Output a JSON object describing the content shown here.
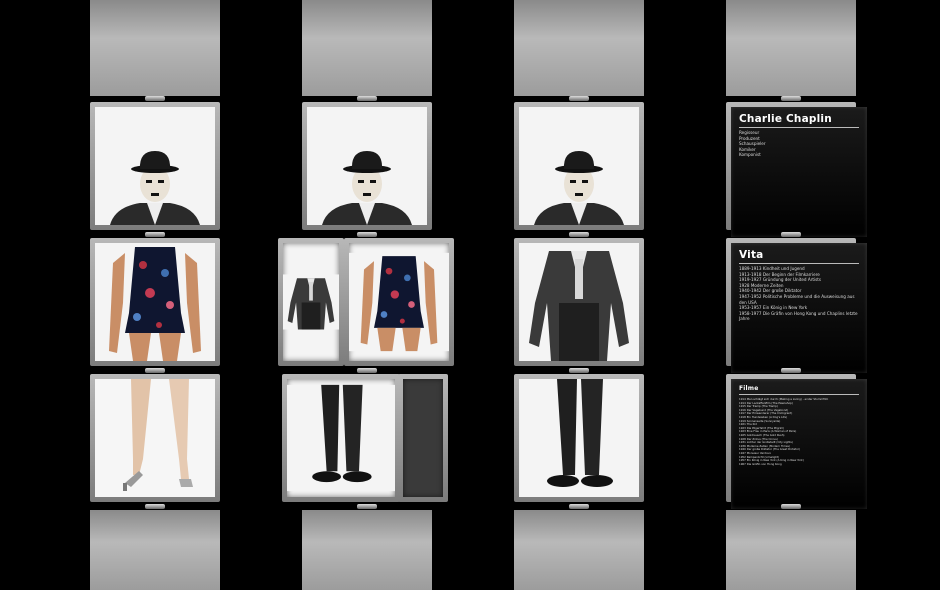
{
  "profile": {
    "name": "Charlie Chaplin",
    "roles": [
      "Regisseur",
      "Produzent",
      "Schauspieler",
      "Komiker",
      "Komponist"
    ]
  },
  "vita": {
    "title": "Vita",
    "entries": [
      "1889-1913 Kindheit und Jugend",
      "1913-1918 Der Beginn der Filmkarriere",
      "1919-1927 Gründung der United Artists",
      "1928      Moderne Zeiten",
      "1940-1942 Der große Diktator",
      "1947-1952 Politische Probleme und die Ausweisung aus den USA",
      "1953-1957 Ein König in New York",
      "1958-1977 Die Gräfin von Hong Kong und Chaplins letzte Jahre"
    ]
  },
  "films": {
    "title": "Filme",
    "entries": [
      "1914 Man schlägt sich durch (Making a Living) - erster Stummfilm",
      "1914 Der Lackaffenfilm (The Pawnshop)",
      "1915 Der Tramp (The Tramp)",
      "1916 Der Vagabund (The Vagabond)",
      "1917 Der Einwanderer (The Immigrant)",
      "1918 Ein Hundeleben (A Dog's Life)",
      "1919 Sonnenseite (Sunnyside)",
      "1921 The Kid",
      "1923 Die Pilgerfahrt (The Pilgrim)",
      "1923 Eine Frau in Paris (A Woman of Paris)",
      "1925 Goldrausch (The Gold Rush)",
      "1928 Der Zirkus (The Circus)",
      "1931 Lichter der Großstadt (City Lights)",
      "1936 Moderne Zeiten (Modern Times)",
      "1940 Der große Diktator (The Great Dictator)",
      "1947 Monsieur Verdoux",
      "1952 Rampenlicht (Limelight)",
      "1957 Ein König in New York (A King in New York)",
      "1967 Die Gräfin von Hong Kong"
    ]
  },
  "icons": {
    "head": "chaplin-portrait",
    "torso_suit": "chaplin-jacket-torso",
    "torso_outfit": "floral-outfit-torso",
    "legs_trousers": "chaplin-trouser-legs",
    "legs_bare": "bare-legs-high-heels"
  },
  "colors": {
    "background": "#000000",
    "frame": "#9a9a9a",
    "text_panel": "#111111"
  }
}
